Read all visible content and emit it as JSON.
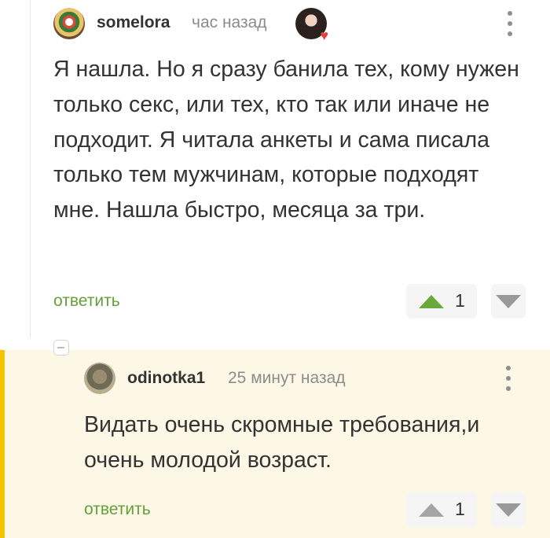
{
  "comment1": {
    "username": "somelora",
    "time": "час назад",
    "text": "Я нашла. Но я сразу банила тех, кому нужен только секс, или тех, кто так или иначе не подходит. Я читала анкеты и сама писала только тем мужчинам, которые подходят мне. Нашла быстро, месяца за три.",
    "reply_label": "ответить",
    "rating": "1",
    "vote_color": "#6aa83b"
  },
  "comment2": {
    "username": "odinotka1",
    "time": "25 минут назад",
    "text": "Видать очень скромные требования,и очень молодой возраст.",
    "reply_label": "ответить",
    "rating": "1",
    "vote_color": "#a5a5a5"
  },
  "icons": {
    "heart": "♥",
    "reply_highlight": "#f5c400",
    "reply_background": "#fdf8e6"
  }
}
